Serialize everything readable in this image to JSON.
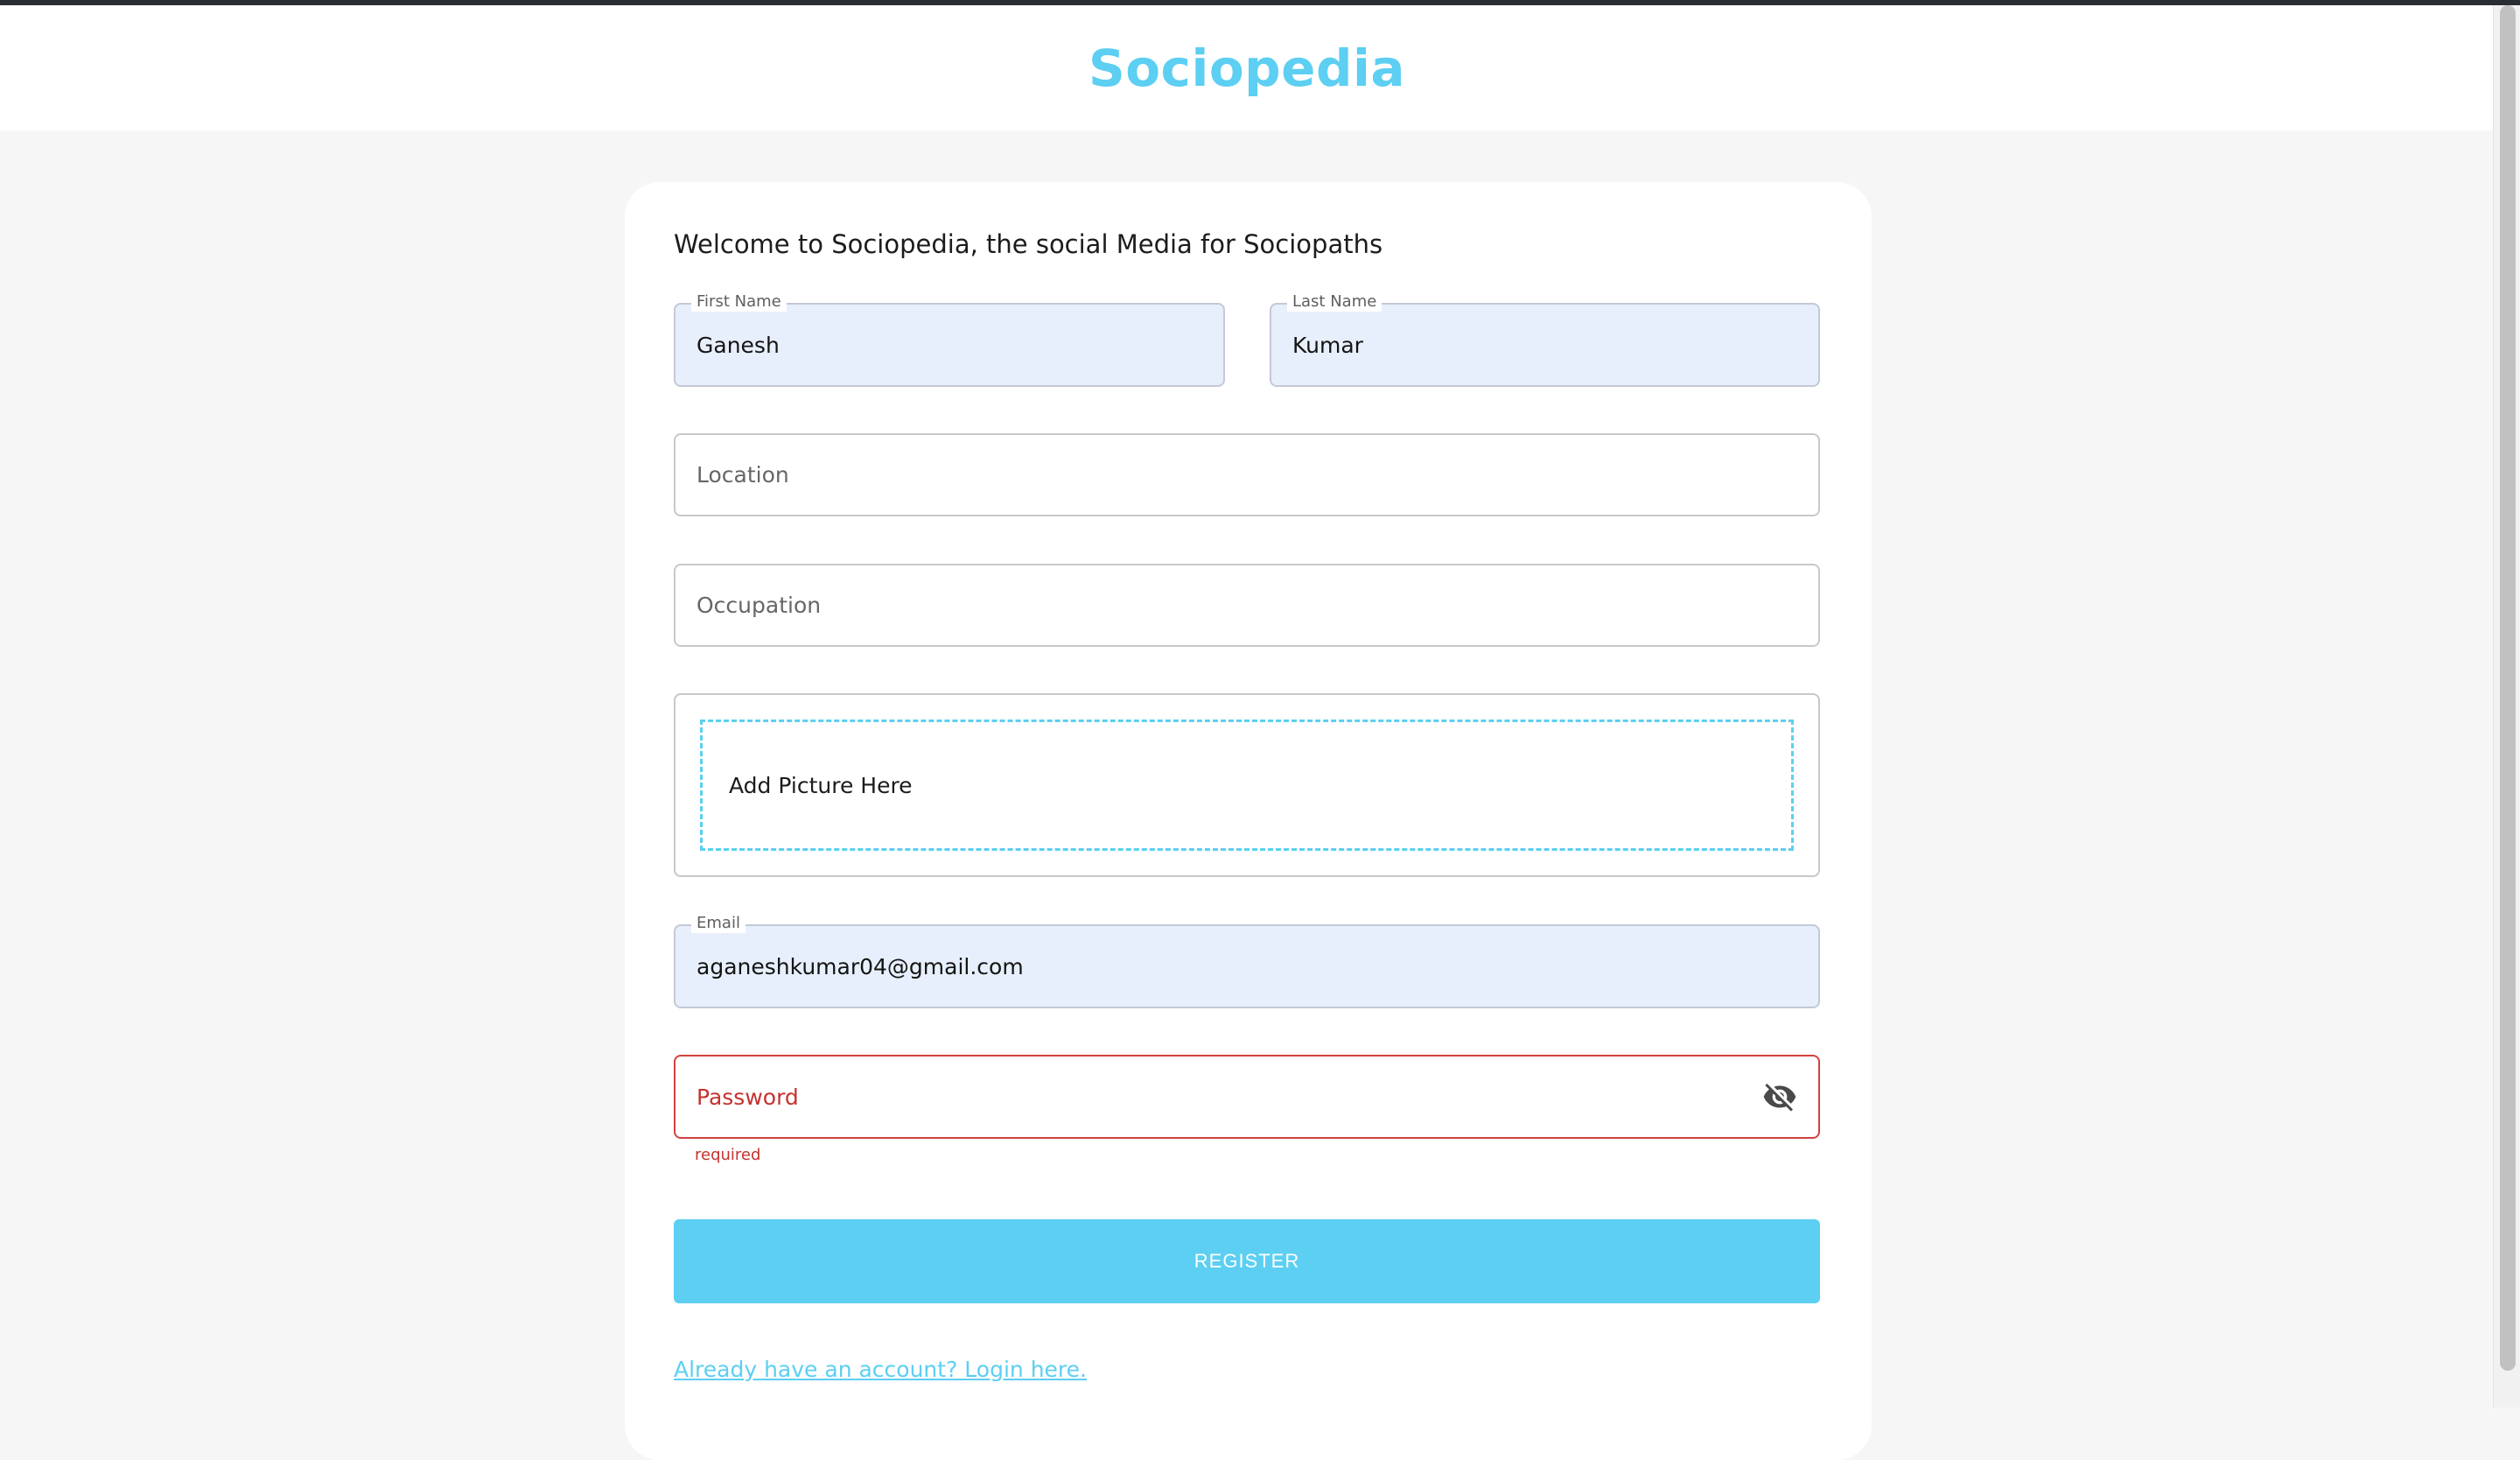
{
  "app": {
    "brand": "Sociopedia"
  },
  "form": {
    "welcome": "Welcome to Sociopedia, the social Media for Sociopaths",
    "first_name": {
      "label": "First Name",
      "value": "Ganesh"
    },
    "last_name": {
      "label": "Last Name",
      "value": "Kumar"
    },
    "location": {
      "placeholder": "Location",
      "value": ""
    },
    "occupation": {
      "placeholder": "Occupation",
      "value": ""
    },
    "picture": {
      "placeholder": "Add Picture Here"
    },
    "email": {
      "label": "Email",
      "value": "aganeshkumar04@gmail.com"
    },
    "password": {
      "placeholder": "Password",
      "helper": "required",
      "visibility_icon": "visibility-off-icon"
    },
    "register_label": "REGISTER",
    "login_link": "Already have an account? Login here."
  },
  "colors": {
    "brand": "#5ccff2",
    "error": "#d4403d",
    "autofill_background": "#e8effc"
  }
}
